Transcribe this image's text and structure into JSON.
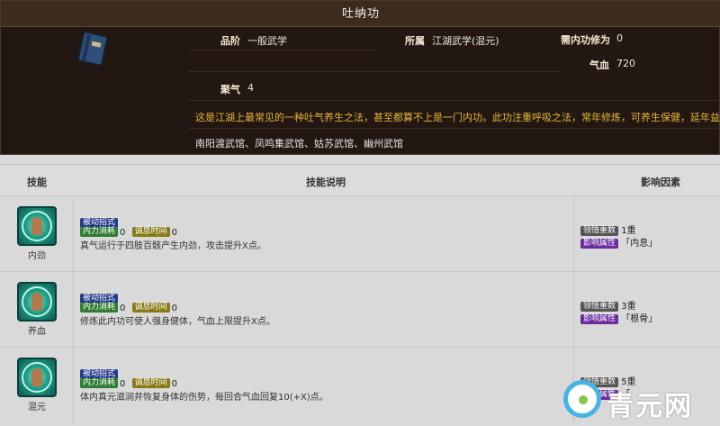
{
  "skill_card": {
    "title": "吐纳功",
    "grade_label": "品阶",
    "grade_value": "一般武学",
    "belongs_label": "所属",
    "belongs_value": "江湖武学(混元)",
    "req_label": "需内功修为",
    "req_value": "0",
    "hp_label": "气血",
    "hp_value": "720",
    "gather_label": "聚气",
    "gather_value": "4",
    "description": "这是江湖上最常见的一种吐气养生之法，甚至都算不上是一门内功。此功注重呼吸之法，常年修炼，可养生保健，延年益寿。",
    "halls": "南阳渡武馆、凤鸣集武馆、姑苏武馆、幽州武馆",
    "icon": "book-icon"
  },
  "table": {
    "headers": {
      "skill": "技能",
      "desc": "技能说明",
      "factor": "影响因素"
    },
    "rows": [
      {
        "name": "内劲",
        "icon": "meditation-icon",
        "type_tag": "被动招式",
        "cost_tag": "内力消耗",
        "cost_value": "0",
        "cd_tag": "调息时间",
        "cd_value": "0",
        "text": "真气运行于四肢百骸产生内劲，攻击提升X点。",
        "f1_tag": "领悟重数",
        "f1_value": "1重",
        "f2_tag": "影响属性",
        "f2_value": "「内息」"
      },
      {
        "name": "养血",
        "icon": "meditation-icon",
        "type_tag": "被动招式",
        "cost_tag": "内力消耗",
        "cost_value": "0",
        "cd_tag": "调息时间",
        "cd_value": "0",
        "text": "修炼此内功可使人强身健体，气血上限提升X点。",
        "f1_tag": "领悟重数",
        "f1_value": "3重",
        "f2_tag": "影响属性",
        "f2_value": "「根骨」"
      },
      {
        "name": "混元",
        "icon": "meditation-icon",
        "type_tag": "被动招式",
        "cost_tag": "内力消耗",
        "cost_value": "0",
        "cd_tag": "调息时间",
        "cd_value": "0",
        "text": "体内真元滋润并恢复身体的伤势，每回合气血回复10(+X)点。",
        "f1_tag": "领悟重数",
        "f1_value": "5重",
        "f2_tag": "影响属性",
        "f2_value": "「"
      }
    ]
  },
  "watermark": {
    "text": "青元网",
    "icon": "logo-icon"
  }
}
